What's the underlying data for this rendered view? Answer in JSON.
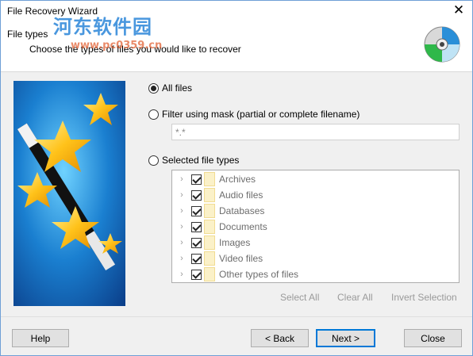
{
  "window": {
    "title": "File Recovery Wizard",
    "close_glyph": "✕"
  },
  "header": {
    "title": "File types",
    "subtitle": "Choose the types of files you would like to recover",
    "watermark": "河东软件园",
    "watermark_url": "www.pc0359.cn",
    "icon": "cd-disc-icon"
  },
  "options": {
    "all_files": "All files",
    "filter_mask": "Filter using mask (partial or complete filename)",
    "mask_value": "*.*",
    "selected_types": "Selected file types",
    "selected": "all_files"
  },
  "file_types": [
    {
      "label": "Archives",
      "checked": true
    },
    {
      "label": "Audio files",
      "checked": true
    },
    {
      "label": "Databases",
      "checked": true
    },
    {
      "label": "Documents",
      "checked": true
    },
    {
      "label": "Images",
      "checked": true
    },
    {
      "label": "Video files",
      "checked": true
    },
    {
      "label": "Other types of files",
      "checked": true
    }
  ],
  "selection_buttons": {
    "select_all": "Select All",
    "clear_all": "Clear All",
    "invert": "Invert Selection"
  },
  "footer": {
    "help": "Help",
    "back": "< Back",
    "next": "Next >",
    "close": "Close"
  },
  "colors": {
    "accent": "#0078d7",
    "sidebar_bg": "#1a6fb8",
    "watermark": "#2a85d9"
  }
}
